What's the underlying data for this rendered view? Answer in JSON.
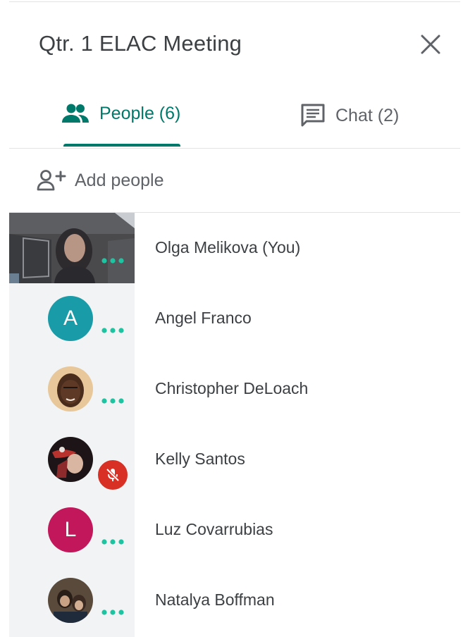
{
  "panel": {
    "title": "Qtr. 1 ELAC Meeting"
  },
  "tabs": [
    {
      "label": "People (6)",
      "icon": "people-icon",
      "active": true
    },
    {
      "label": "Chat (2)",
      "icon": "chat-icon",
      "active": false
    }
  ],
  "add_people": {
    "label": "Add people",
    "icon": "add-person-icon"
  },
  "participants": [
    {
      "name": "Olga Melikova (You)",
      "media": "video-tile"
    },
    {
      "name": "Angel Franco",
      "avatar_letter": "A",
      "avatar_color": "#1a9ba8"
    },
    {
      "name": "Christopher DeLoach",
      "media": "photo-avatar"
    },
    {
      "name": "Kelly Santos",
      "media": "photo-avatar",
      "muted": true
    },
    {
      "name": "Luz Covarrubias",
      "avatar_letter": "L",
      "avatar_color": "#c2185b"
    },
    {
      "name": "Natalya Boffman",
      "media": "photo-avatar"
    }
  ],
  "colors": {
    "accent": "#00796b",
    "speaking_dots": "#1ec4a1",
    "muted_badge": "#d93025",
    "left_column": "#f1f3f4"
  }
}
